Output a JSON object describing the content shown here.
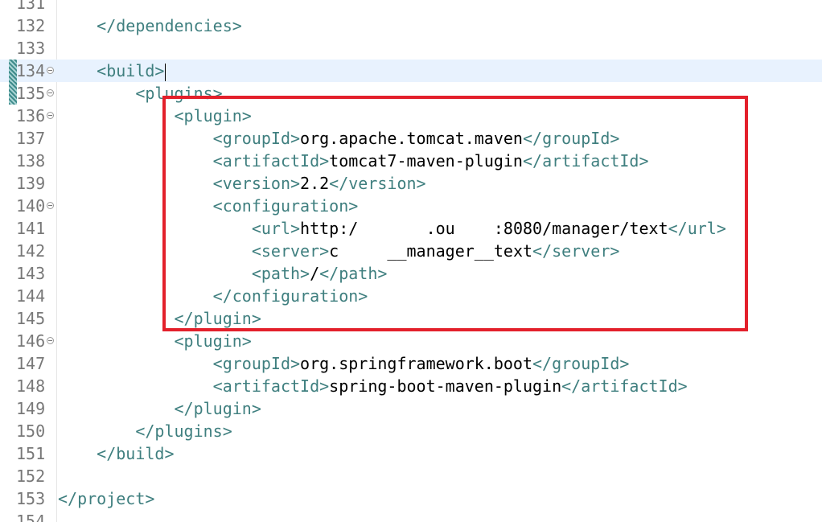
{
  "editor": {
    "lines": [
      {
        "num": "131",
        "indent": "",
        "tokens": []
      },
      {
        "num": "132",
        "indent": "    ",
        "tokens": [
          {
            "t": "tag",
            "v": "</dependencies>"
          }
        ]
      },
      {
        "num": "133",
        "indent": "",
        "tokens": []
      },
      {
        "num": "134",
        "indent": "    ",
        "fold": true,
        "marker": true,
        "current": true,
        "caret": true,
        "tokens": [
          {
            "t": "tag",
            "v": "<build>"
          }
        ]
      },
      {
        "num": "135",
        "indent": "        ",
        "fold": true,
        "marker": true,
        "tokens": [
          {
            "t": "tag",
            "v": "<plugins>"
          }
        ]
      },
      {
        "num": "136",
        "indent": "            ",
        "fold": true,
        "tokens": [
          {
            "t": "tag",
            "v": "<plugin>"
          }
        ]
      },
      {
        "num": "137",
        "indent": "                ",
        "tokens": [
          {
            "t": "tag",
            "v": "<groupId>"
          },
          {
            "t": "text",
            "v": "org.apache.tomcat.maven"
          },
          {
            "t": "tag",
            "v": "</groupId>"
          }
        ]
      },
      {
        "num": "138",
        "indent": "                ",
        "tokens": [
          {
            "t": "tag",
            "v": "<artifactId>"
          },
          {
            "t": "text",
            "v": "tomcat7-maven-plugin"
          },
          {
            "t": "tag",
            "v": "</artifactId>"
          }
        ]
      },
      {
        "num": "139",
        "indent": "                ",
        "tokens": [
          {
            "t": "tag",
            "v": "<version>"
          },
          {
            "t": "text",
            "v": "2.2"
          },
          {
            "t": "tag",
            "v": "</version>"
          }
        ]
      },
      {
        "num": "140",
        "indent": "                ",
        "fold": true,
        "tokens": [
          {
            "t": "tag",
            "v": "<configuration>"
          }
        ]
      },
      {
        "num": "141",
        "indent": "                    ",
        "tokens": [
          {
            "t": "tag",
            "v": "<url>"
          },
          {
            "t": "text",
            "v": "http:/"
          },
          {
            "t": "redact",
            "v": "       "
          },
          {
            "t": "text",
            "v": ".ou"
          },
          {
            "t": "redact",
            "v": "    "
          },
          {
            "t": "text",
            "v": ":8080/manager/text"
          },
          {
            "t": "tag",
            "v": "</url>"
          }
        ]
      },
      {
        "num": "142",
        "indent": "                    ",
        "tokens": [
          {
            "t": "tag",
            "v": "<server>"
          },
          {
            "t": "text",
            "v": "c"
          },
          {
            "t": "redact",
            "v": "     "
          },
          {
            "t": "text",
            "v": "__manager__text"
          },
          {
            "t": "tag",
            "v": "</server>"
          }
        ]
      },
      {
        "num": "143",
        "indent": "                    ",
        "tokens": [
          {
            "t": "tag",
            "v": "<path>"
          },
          {
            "t": "text",
            "v": "/"
          },
          {
            "t": "tag",
            "v": "</path>"
          }
        ]
      },
      {
        "num": "144",
        "indent": "                ",
        "tokens": [
          {
            "t": "tag",
            "v": "</configuration>"
          }
        ]
      },
      {
        "num": "145",
        "indent": "            ",
        "tokens": [
          {
            "t": "tag",
            "v": "</plugin>"
          }
        ]
      },
      {
        "num": "146",
        "indent": "            ",
        "fold": true,
        "tokens": [
          {
            "t": "tag",
            "v": "<plugin>"
          }
        ]
      },
      {
        "num": "147",
        "indent": "                ",
        "tokens": [
          {
            "t": "tag",
            "v": "<groupId>"
          },
          {
            "t": "text",
            "v": "org.springframework.boot"
          },
          {
            "t": "tag",
            "v": "</groupId>"
          }
        ]
      },
      {
        "num": "148",
        "indent": "                ",
        "tokens": [
          {
            "t": "tag",
            "v": "<artifactId>"
          },
          {
            "t": "text",
            "v": "spring-boot-maven-plugin"
          },
          {
            "t": "tag",
            "v": "</artifactId>"
          }
        ]
      },
      {
        "num": "149",
        "indent": "            ",
        "tokens": [
          {
            "t": "tag",
            "v": "</plugin>"
          }
        ]
      },
      {
        "num": "150",
        "indent": "        ",
        "tokens": [
          {
            "t": "tag",
            "v": "</plugins>"
          }
        ]
      },
      {
        "num": "151",
        "indent": "    ",
        "tokens": [
          {
            "t": "tag",
            "v": "</build>"
          }
        ]
      },
      {
        "num": "152",
        "indent": "",
        "tokens": []
      },
      {
        "num": "153",
        "indent": "",
        "tokens": [
          {
            "t": "tag",
            "v": "</project>"
          }
        ]
      },
      {
        "num": "154",
        "indent": "",
        "tokens": []
      }
    ]
  },
  "colors": {
    "tag": "#3f7f7f",
    "text": "#000000",
    "line_number": "#787878",
    "current_line": "#e8f2fe",
    "highlight_box": "#e3202b"
  }
}
